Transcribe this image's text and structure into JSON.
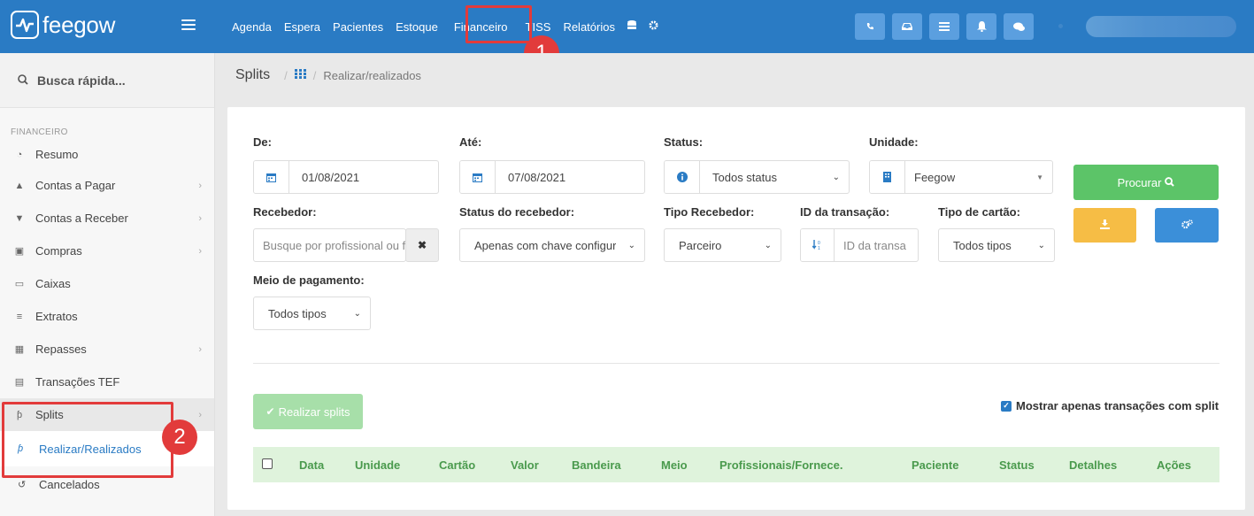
{
  "app": {
    "brand": "feegow"
  },
  "topnav": {
    "items": [
      "Agenda",
      "Espera",
      "Pacientes",
      "Estoque",
      "Financeiro",
      "TISS",
      "Relatórios"
    ],
    "icons": [
      "database-icon",
      "gear-icon"
    ],
    "actions": [
      "phone-icon",
      "inbox-icon",
      "list-icon",
      "bell-icon",
      "chat-icon"
    ]
  },
  "annotations": {
    "marker1": "1",
    "marker2": "2",
    "color": "#e23b3b"
  },
  "sidebar": {
    "search_label": "Busca rápida...",
    "section": "FINANCEIRO",
    "items": [
      {
        "label": "Resumo",
        "icon": "pie-chart-icon",
        "chevron": false
      },
      {
        "label": "Contas a Pagar",
        "icon": "arrow-up-circle-icon",
        "chevron": true
      },
      {
        "label": "Contas a Receber",
        "icon": "arrow-down-circle-icon",
        "chevron": true
      },
      {
        "label": "Compras",
        "icon": "cart-icon",
        "chevron": true
      },
      {
        "label": "Caixas",
        "icon": "inbox-icon",
        "chevron": false
      },
      {
        "label": "Extratos",
        "icon": "list-icon",
        "chevron": false
      },
      {
        "label": "Repasses",
        "icon": "sitemap-icon",
        "chevron": true
      },
      {
        "label": "Transações TEF",
        "icon": "credit-card-icon",
        "chevron": false
      },
      {
        "label": "Splits",
        "icon": "split-icon",
        "chevron": true
      }
    ],
    "subitems": [
      {
        "label": "Realizar/Realizados",
        "icon": "split-icon"
      },
      {
        "label": "Cancelados",
        "icon": "history-icon"
      }
    ]
  },
  "breadcrumb": {
    "title": "Splits",
    "current": "Realizar/realizados"
  },
  "filters": {
    "de": {
      "label": "De:",
      "value": "01/08/2021"
    },
    "ate": {
      "label": "Até:",
      "value": "07/08/2021"
    },
    "status": {
      "label": "Status:",
      "value": "Todos status"
    },
    "unidade": {
      "label": "Unidade:",
      "value": "Feegow"
    },
    "recebedor": {
      "label": "Recebedor:",
      "placeholder": "Busque por profissional ou f"
    },
    "status_recebedor": {
      "label": "Status do recebedor:",
      "value": "Apenas com chave configur"
    },
    "tipo_recebedor": {
      "label": "Tipo Recebedor:",
      "value": "Parceiro"
    },
    "id_transacao": {
      "label": "ID da transação:",
      "placeholder": "ID da transa"
    },
    "tipo_cartao": {
      "label": "Tipo de cartão:",
      "value": "Todos tipos"
    },
    "meio_pagamento": {
      "label": "Meio de pagamento:",
      "value": "Todos tipos"
    }
  },
  "buttons": {
    "procurar": "Procurar",
    "realizar": "Realizar splits"
  },
  "options": {
    "mostrar_apenas": "Mostrar apenas transações com split"
  },
  "table": {
    "columns": [
      "Data",
      "Unidade",
      "Cartão",
      "Valor",
      "Bandeira",
      "Meio",
      "Profissionais/Fornece.",
      "Paciente",
      "Status",
      "Detalhes",
      "Ações"
    ]
  }
}
